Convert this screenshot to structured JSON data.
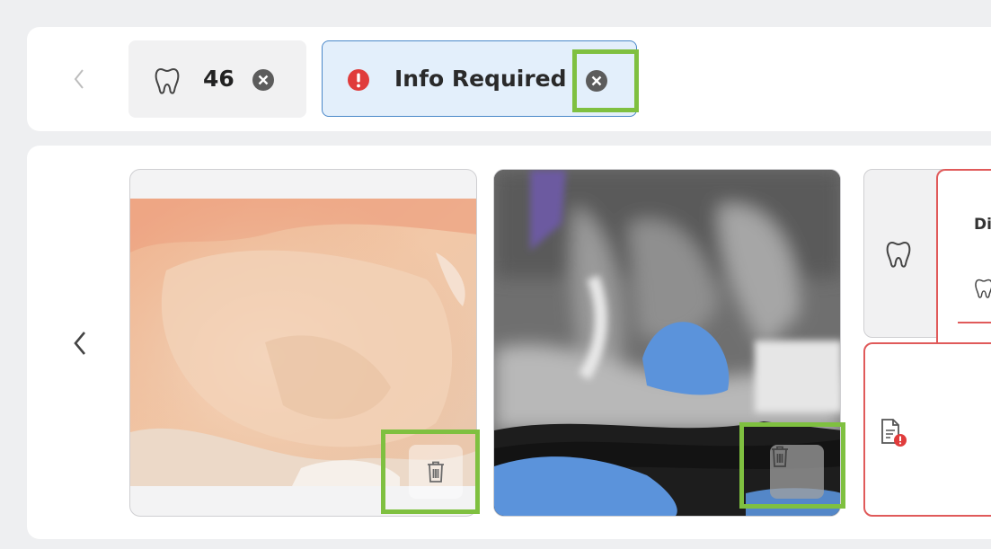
{
  "filters": {
    "tooth_chip": {
      "number": "46",
      "icon": "tooth-icon",
      "remove_icon": "close-circle-icon"
    },
    "status_chip": {
      "label": "Info Required",
      "icon": "exclamation-circle-icon",
      "remove_icon": "close-circle-icon"
    }
  },
  "gallery": {
    "images": [
      {
        "kind": "intraoral-photo",
        "delete_icon": "trash-icon"
      },
      {
        "kind": "xray",
        "delete_icon": "trash-icon"
      }
    ]
  },
  "side_panel": {
    "header_partial": "Di",
    "tabs": [
      {
        "icon": "tooth-icon"
      },
      {
        "icon": "document-alert-icon"
      }
    ]
  },
  "colors": {
    "accent_blue": "#4a88c9",
    "chip_blue_bg": "#e3effb",
    "alert_red": "#e03c3c",
    "highlight_green": "#7fc040"
  }
}
